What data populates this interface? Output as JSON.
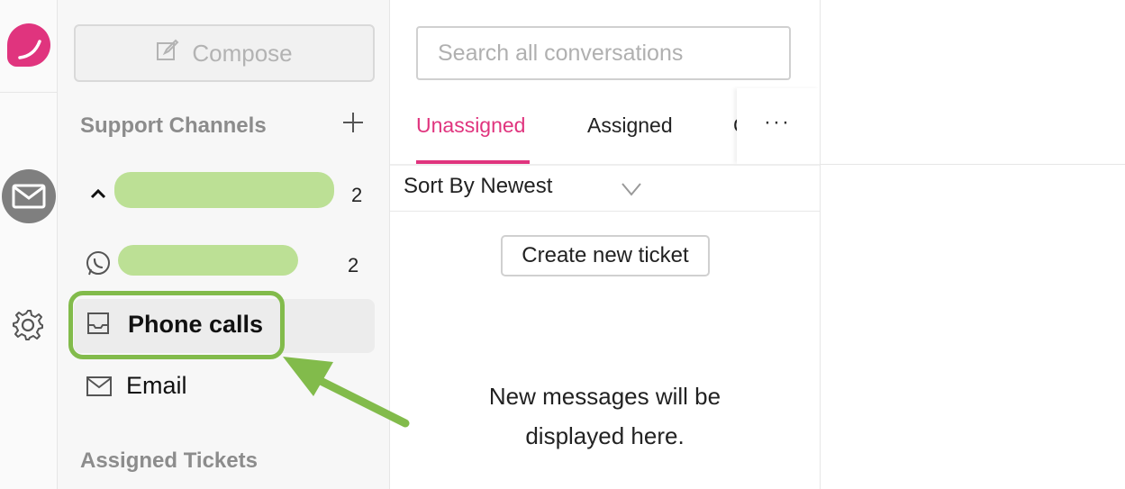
{
  "rail": {
    "logo_icon": "brand-logo-icon",
    "inbox_icon": "mail-icon",
    "settings_icon": "gear-icon"
  },
  "sidebar": {
    "compose_label": "Compose",
    "support_channels_title": "Support Channels",
    "channels": [
      {
        "icon": "chevron-up-icon",
        "label_redacted": true,
        "count": "2"
      },
      {
        "icon": "whatsapp-icon",
        "label_redacted": true,
        "count": "2"
      },
      {
        "icon": "inbox-tray-icon",
        "label": "Phone calls",
        "active": true
      },
      {
        "icon": "mail-icon",
        "label": "Email"
      }
    ],
    "assigned_tickets_title": "Assigned Tickets"
  },
  "conversations": {
    "search_placeholder": "Search all conversations",
    "tabs": [
      {
        "label": "Unassigned",
        "active": true
      },
      {
        "label": "Assigned"
      }
    ],
    "more_label": "···",
    "sort_label": "Sort By Newest",
    "create_ticket_label": "Create new ticket",
    "empty_message": "New messages will be displayed here."
  },
  "colors": {
    "accent": "#e0347e",
    "highlight": "#82bb4b",
    "redaction": "#bce095"
  }
}
